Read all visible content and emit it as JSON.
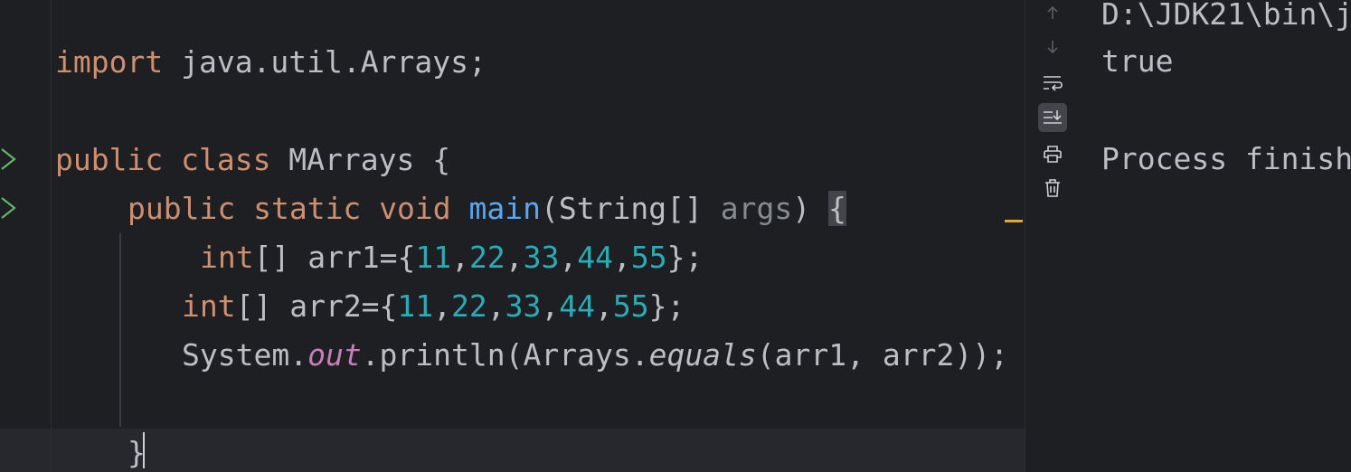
{
  "editor": {
    "lines": {
      "import": {
        "keyword": "import",
        "text": " java.util.Arrays;"
      },
      "class_decl": {
        "kw1": "public",
        "kw2": "class",
        "name": " MArrays ",
        "brace": "{"
      },
      "main_decl": {
        "kw1": "public",
        "kw2": "static",
        "kw3": "void",
        "name": "main",
        "open": "(String[] ",
        "param": "args",
        "close": ") ",
        "brace": "{"
      },
      "arr1": {
        "kw": "int",
        "pre": "[] arr1={",
        "n1": "11",
        "n2": "22",
        "n3": "33",
        "n4": "44",
        "n5": "55",
        "post": "};"
      },
      "arr2": {
        "kw": "int",
        "pre": "[] arr2={",
        "n1": "11",
        "n2": "22",
        "n3": "33",
        "n4": "44",
        "n5": "55",
        "post": "};"
      },
      "println": {
        "cls": "System.",
        "field": "out",
        "mid": ".println(Arrays.",
        "method": "equals",
        "args": "(arr1, arr2));"
      },
      "close_main": {
        "brace": "}"
      }
    },
    "run_icon": "run-arrow-icon",
    "colors": {
      "keyword": "#cf8e6d",
      "number": "#2aacb8",
      "method": "#56a8f5",
      "static_field": "#c77dbb",
      "text": "#bcbec4",
      "run_icon": "#5fb865"
    }
  },
  "toolbar": {
    "buttons": [
      {
        "icon": "arrow-up-icon"
      },
      {
        "icon": "arrow-down-icon"
      },
      {
        "icon": "soft-wrap-icon"
      },
      {
        "icon": "scroll-to-end-icon",
        "active": true
      },
      {
        "icon": "print-icon"
      },
      {
        "icon": "trash-icon"
      }
    ]
  },
  "console": {
    "line1": "D:\\JDK21\\bin\\j",
    "line2": "true",
    "line3": "Process finish"
  }
}
